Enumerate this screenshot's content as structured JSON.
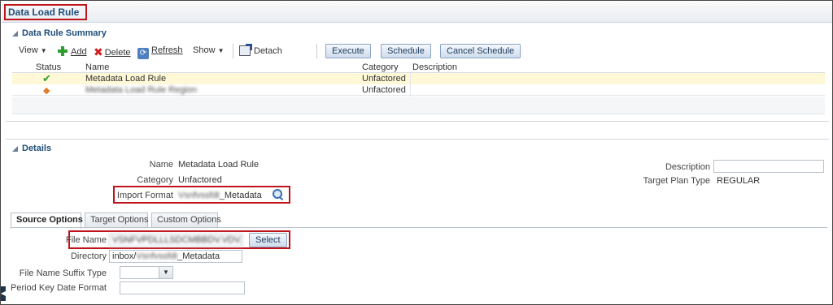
{
  "page": {
    "title": "Data Load Rule"
  },
  "summary": {
    "header": "Data Rule Summary",
    "toolbar": {
      "view": "View",
      "add": "Add",
      "delete": "Delete",
      "refresh": "Refresh",
      "show": "Show",
      "detach": "Detach",
      "execute": "Execute",
      "schedule": "Schedule",
      "cancel_schedule": "Cancel Schedule"
    },
    "columns": {
      "status": "Status",
      "name": "Name",
      "category": "Category",
      "description": "Description"
    },
    "rows": [
      {
        "status_icon": "check-icon",
        "name": "Metadata Load Rule",
        "category": "Unfactored",
        "description": ""
      },
      {
        "status_icon": "diamond-warning-icon",
        "name": "Metadata Load Rule Region",
        "category": "Unfactored",
        "description": ""
      }
    ]
  },
  "details": {
    "header": "Details",
    "name_label": "Name",
    "name_value": "Metadata Load Rule",
    "category_label": "Category",
    "category_value": "Unfactored",
    "import_format_label": "Import Format",
    "import_format_prefix": "Vsnfvssfdt",
    "import_format_suffix": "_Metadata",
    "description_label": "Description",
    "description_value": "",
    "target_plan_type_label": "Target Plan Type",
    "target_plan_type_value": "REGULAR"
  },
  "tabs": [
    "Source Options",
    "Target Options",
    "Custom Options"
  ],
  "source_options": {
    "file_name_label": "File Name",
    "file_name_value": "VSNFVPDLLLSDCMBBDV.VDV.DS",
    "select_button": "Select",
    "directory_label": "Directory",
    "directory_prefix": "inbox/",
    "directory_blurred": "Vsnfvssfdt",
    "directory_suffix": "_Metadata",
    "suffix_type_label": "File Name Suffix Type",
    "suffix_type_value": "",
    "period_key_label": "Period Key Date Format"
  }
}
